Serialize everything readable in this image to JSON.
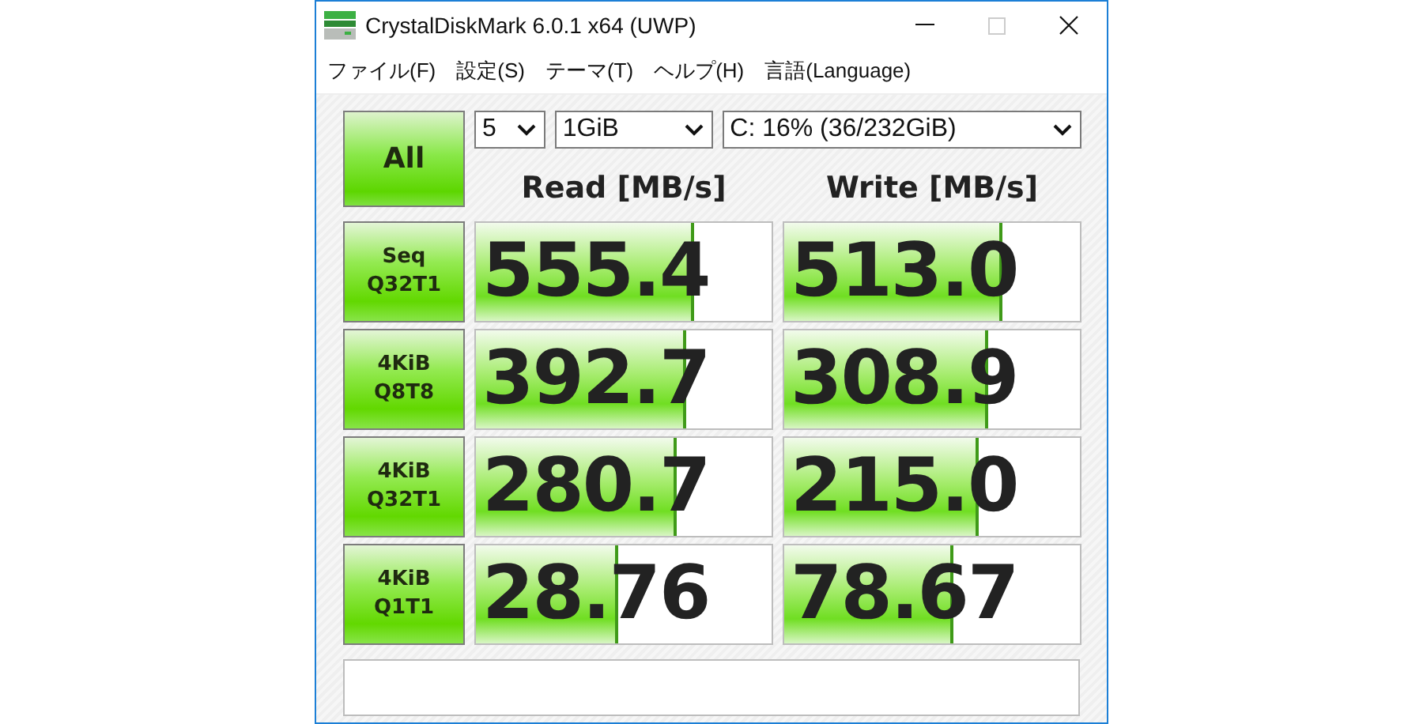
{
  "window": {
    "title": "CrystalDiskMark 6.0.1 x64 (UWP)"
  },
  "menu": [
    {
      "label": "ファイル(F)"
    },
    {
      "label": "設定(S)"
    },
    {
      "label": "テーマ(T)"
    },
    {
      "label": "ヘルプ(H)"
    },
    {
      "label": "言語(Language)"
    }
  ],
  "all_button": {
    "label": "All"
  },
  "settings": {
    "count": "5",
    "size": "1GiB",
    "drive": "C: 16% (36/232GiB)"
  },
  "columns": [
    "Read [MB/s]",
    "Write [MB/s]"
  ],
  "tests": [
    {
      "lines": [
        "Seq",
        "Q32T1"
      ],
      "read": {
        "value": "555.4",
        "level": 0.74
      },
      "write": {
        "value": "513.0",
        "level": 0.74
      }
    },
    {
      "lines": [
        "4KiB",
        "Q8T8"
      ],
      "read": {
        "value": "392.7",
        "level": 0.71
      },
      "write": {
        "value": "308.9",
        "level": 0.69
      }
    },
    {
      "lines": [
        "4KiB",
        "Q32T1"
      ],
      "read": {
        "value": "280.7",
        "level": 0.68
      },
      "write": {
        "value": "215.0",
        "level": 0.66
      }
    },
    {
      "lines": [
        "4KiB",
        "Q1T1"
      ],
      "read": {
        "value": "28.76",
        "level": 0.48
      },
      "write": {
        "value": "78.67",
        "level": 0.57
      }
    }
  ]
}
